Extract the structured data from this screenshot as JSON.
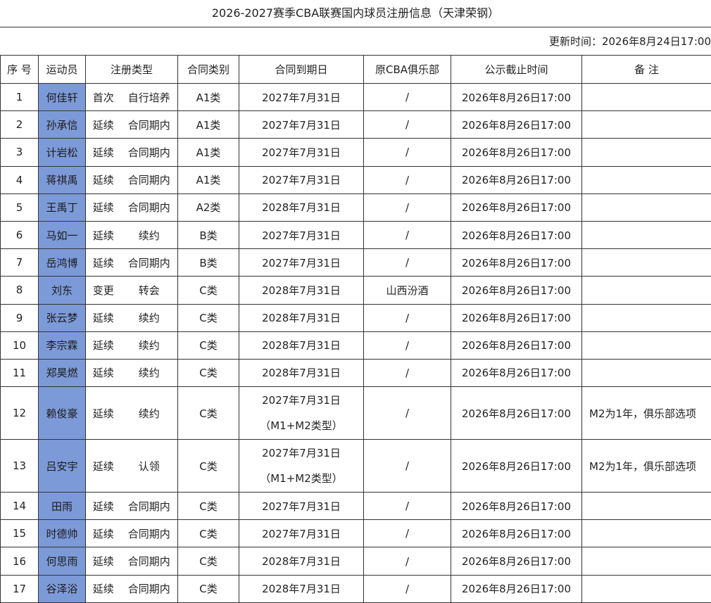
{
  "title": "2026-2027赛季CBA联赛国内球员注册信息（天津荣钢）",
  "updated": "更新时间：2026年8月24日17:00",
  "headers": {
    "no": "序 号",
    "athlete": "运动员",
    "reg_type": "注册类型",
    "contract_cat": "合同类别",
    "expiry": "合同到期日",
    "orig_club": "原CBA俱乐部",
    "deadline": "公示截止时间",
    "remark": "备 注"
  },
  "rows": [
    {
      "no": "1",
      "name": "何佳轩",
      "t1": "首次",
      "t2": "自行培养",
      "cat": "A1类",
      "exp": "2027年7月31日",
      "exp2": "",
      "club": "/",
      "deadline": "2026年8月26日17:00",
      "remark": ""
    },
    {
      "no": "2",
      "name": "孙承信",
      "t1": "延续",
      "t2": "合同期内",
      "cat": "A1类",
      "exp": "2027年7月31日",
      "exp2": "",
      "club": "/",
      "deadline": "2026年8月26日17:00",
      "remark": ""
    },
    {
      "no": "3",
      "name": "计岩松",
      "t1": "延续",
      "t2": "合同期内",
      "cat": "A1类",
      "exp": "2027年7月31日",
      "exp2": "",
      "club": "/",
      "deadline": "2026年8月26日17:00",
      "remark": ""
    },
    {
      "no": "4",
      "name": "蒋祺禹",
      "t1": "延续",
      "t2": "合同期内",
      "cat": "A1类",
      "exp": "2027年7月31日",
      "exp2": "",
      "club": "/",
      "deadline": "2026年8月26日17:00",
      "remark": ""
    },
    {
      "no": "5",
      "name": "王禹丁",
      "t1": "延续",
      "t2": "合同期内",
      "cat": "A2类",
      "exp": "2028年7月31日",
      "exp2": "",
      "club": "/",
      "deadline": "2026年8月26日17:00",
      "remark": ""
    },
    {
      "no": "6",
      "name": "马如一",
      "t1": "延续",
      "t2": "续约",
      "cat": "B类",
      "exp": "2027年7月31日",
      "exp2": "",
      "club": "/",
      "deadline": "2026年8月26日17:00",
      "remark": ""
    },
    {
      "no": "7",
      "name": "岳鸿博",
      "t1": "延续",
      "t2": "合同期内",
      "cat": "B类",
      "exp": "2027年7月31日",
      "exp2": "",
      "club": "/",
      "deadline": "2026年8月26日17:00",
      "remark": ""
    },
    {
      "no": "8",
      "name": "刘东",
      "t1": "变更",
      "t2": "转会",
      "cat": "C类",
      "exp": "2028年7月31日",
      "exp2": "",
      "club": "山西汾酒",
      "deadline": "2026年8月26日17:00",
      "remark": ""
    },
    {
      "no": "9",
      "name": "张云梦",
      "t1": "延续",
      "t2": "续约",
      "cat": "C类",
      "exp": "2028年7月31日",
      "exp2": "",
      "club": "/",
      "deadline": "2026年8月26日17:00",
      "remark": ""
    },
    {
      "no": "10",
      "name": "李宗霖",
      "t1": "延续",
      "t2": "续约",
      "cat": "C类",
      "exp": "2028年7月31日",
      "exp2": "",
      "club": "/",
      "deadline": "2026年8月26日17:00",
      "remark": ""
    },
    {
      "no": "11",
      "name": "郑昊燃",
      "t1": "延续",
      "t2": "续约",
      "cat": "C类",
      "exp": "2028年7月31日",
      "exp2": "",
      "club": "/",
      "deadline": "2026年8月26日17:00",
      "remark": ""
    },
    {
      "no": "12",
      "name": "赖俊豪",
      "t1": "延续",
      "t2": "续约",
      "cat": "C类",
      "exp": "2027年7月31日",
      "exp2": "（M1+M2类型）",
      "club": "/",
      "deadline": "2026年8月26日17:00",
      "remark": "M2为1年，俱乐部选项"
    },
    {
      "no": "13",
      "name": "吕安宇",
      "t1": "延续",
      "t2": "认领",
      "cat": "C类",
      "exp": "2027年7月31日",
      "exp2": "（M1+M2类型）",
      "club": "/",
      "deadline": "2026年8月26日17:00",
      "remark": "M2为1年，俱乐部选项"
    },
    {
      "no": "14",
      "name": "田雨",
      "t1": "延续",
      "t2": "合同期内",
      "cat": "C类",
      "exp": "2027年7月31日",
      "exp2": "",
      "club": "/",
      "deadline": "2026年8月26日17:00",
      "remark": ""
    },
    {
      "no": "15",
      "name": "时德帅",
      "t1": "延续",
      "t2": "合同期内",
      "cat": "C类",
      "exp": "2027年7月31日",
      "exp2": "",
      "club": "/",
      "deadline": "2026年8月26日17:00",
      "remark": ""
    },
    {
      "no": "16",
      "name": "何思雨",
      "t1": "延续",
      "t2": "合同期内",
      "cat": "C类",
      "exp": "2028年7月31日",
      "exp2": "",
      "club": "/",
      "deadline": "2026年8月26日17:00",
      "remark": ""
    },
    {
      "no": "17",
      "name": "谷泽浴",
      "t1": "延续",
      "t2": "合同期内",
      "cat": "C类",
      "exp": "2028年7月31日",
      "exp2": "",
      "club": "/",
      "deadline": "2026年8月26日17:00",
      "remark": ""
    }
  ],
  "colors": {
    "name_highlight": "#7d9ad8",
    "border": "#333333"
  }
}
